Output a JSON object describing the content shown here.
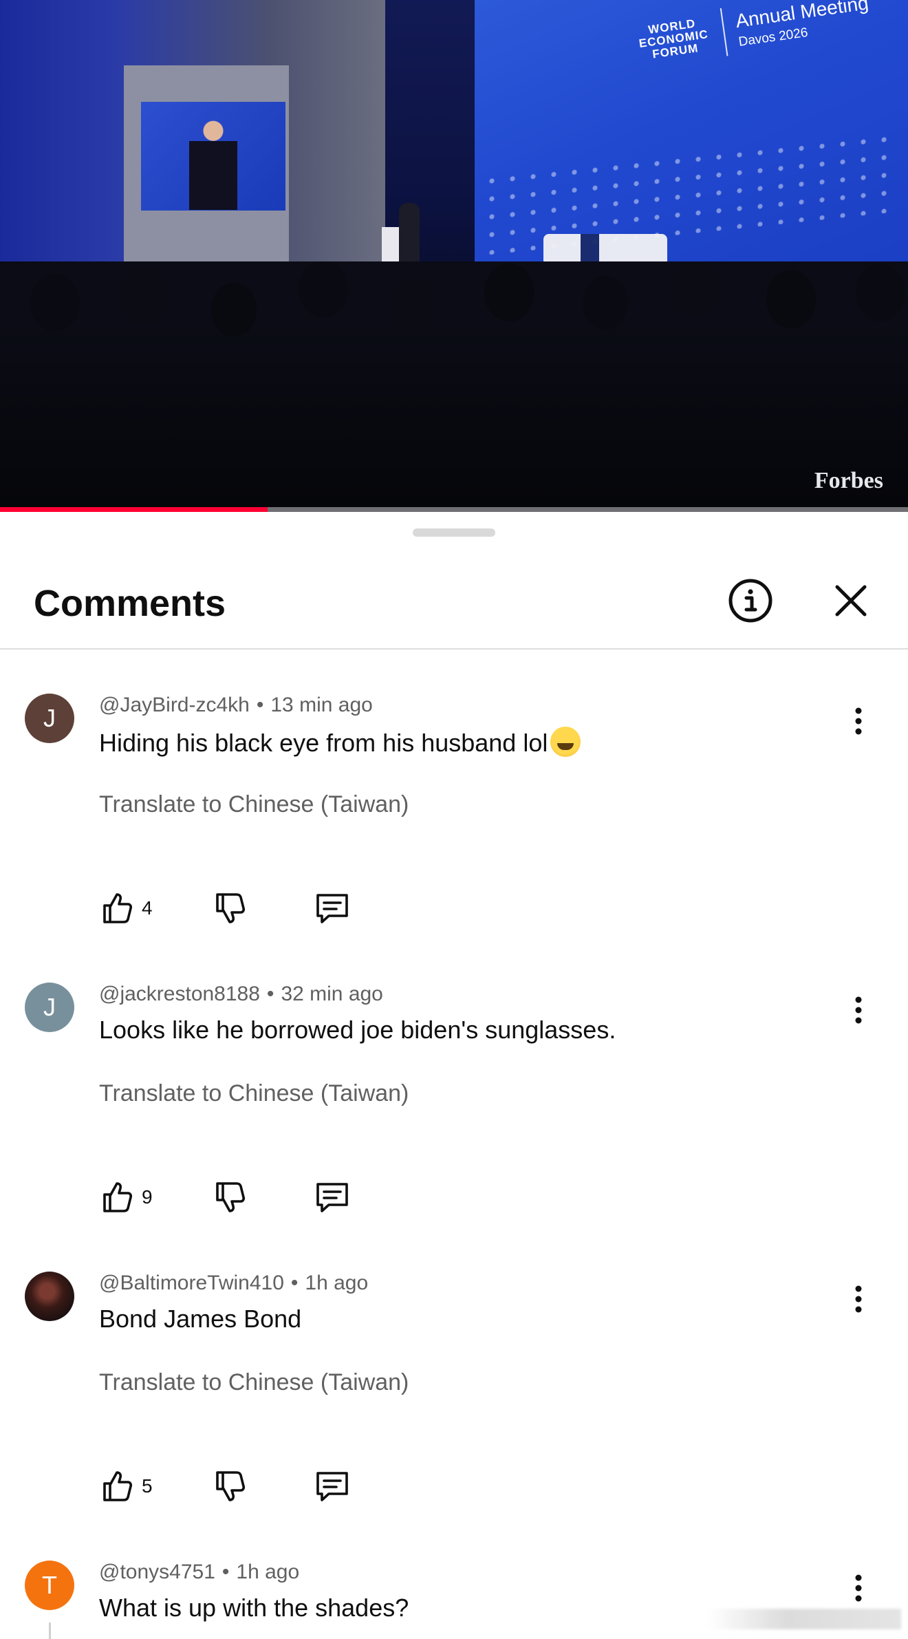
{
  "video": {
    "logo_org": "WORLD ECONOMIC FORUM",
    "logo_event": "Annual Meeting",
    "logo_event_sub": "Davos 2026",
    "watermark": "Forbes",
    "progress_fraction": 0.295,
    "progress_color": "#ff0033"
  },
  "sheet": {
    "title": "Comments",
    "info_icon": "info-circle-icon",
    "close_icon": "close-x-icon"
  },
  "comments": [
    {
      "avatar_letter": "J",
      "avatar_color": "#5d4037",
      "author": "@JayBird-zc4kh",
      "time": "13 min ago",
      "text": "Hiding his black eye from his husband lol",
      "emoji": "grinning-sweat-emoji",
      "translate": "Translate to Chinese (Taiwan)",
      "likes": "4"
    },
    {
      "avatar_letter": "J",
      "avatar_color": "#78909c",
      "author": "@jackreston8188",
      "time": "32 min ago",
      "text": "Looks like he borrowed joe biden's sunglasses.",
      "translate": "Translate to Chinese (Taiwan)",
      "likes": "9"
    },
    {
      "avatar_letter": "",
      "avatar_color": "#2a1614",
      "author": "@BaltimoreTwin410",
      "time": "1h ago",
      "text": "Bond James Bond",
      "translate": "Translate to Chinese (Taiwan)",
      "likes": "5"
    },
    {
      "avatar_letter": "T",
      "avatar_color": "#f4730f",
      "author": "@tonys4751",
      "time": "1h ago",
      "text": "What is up with the shades?"
    }
  ],
  "separator": "•"
}
